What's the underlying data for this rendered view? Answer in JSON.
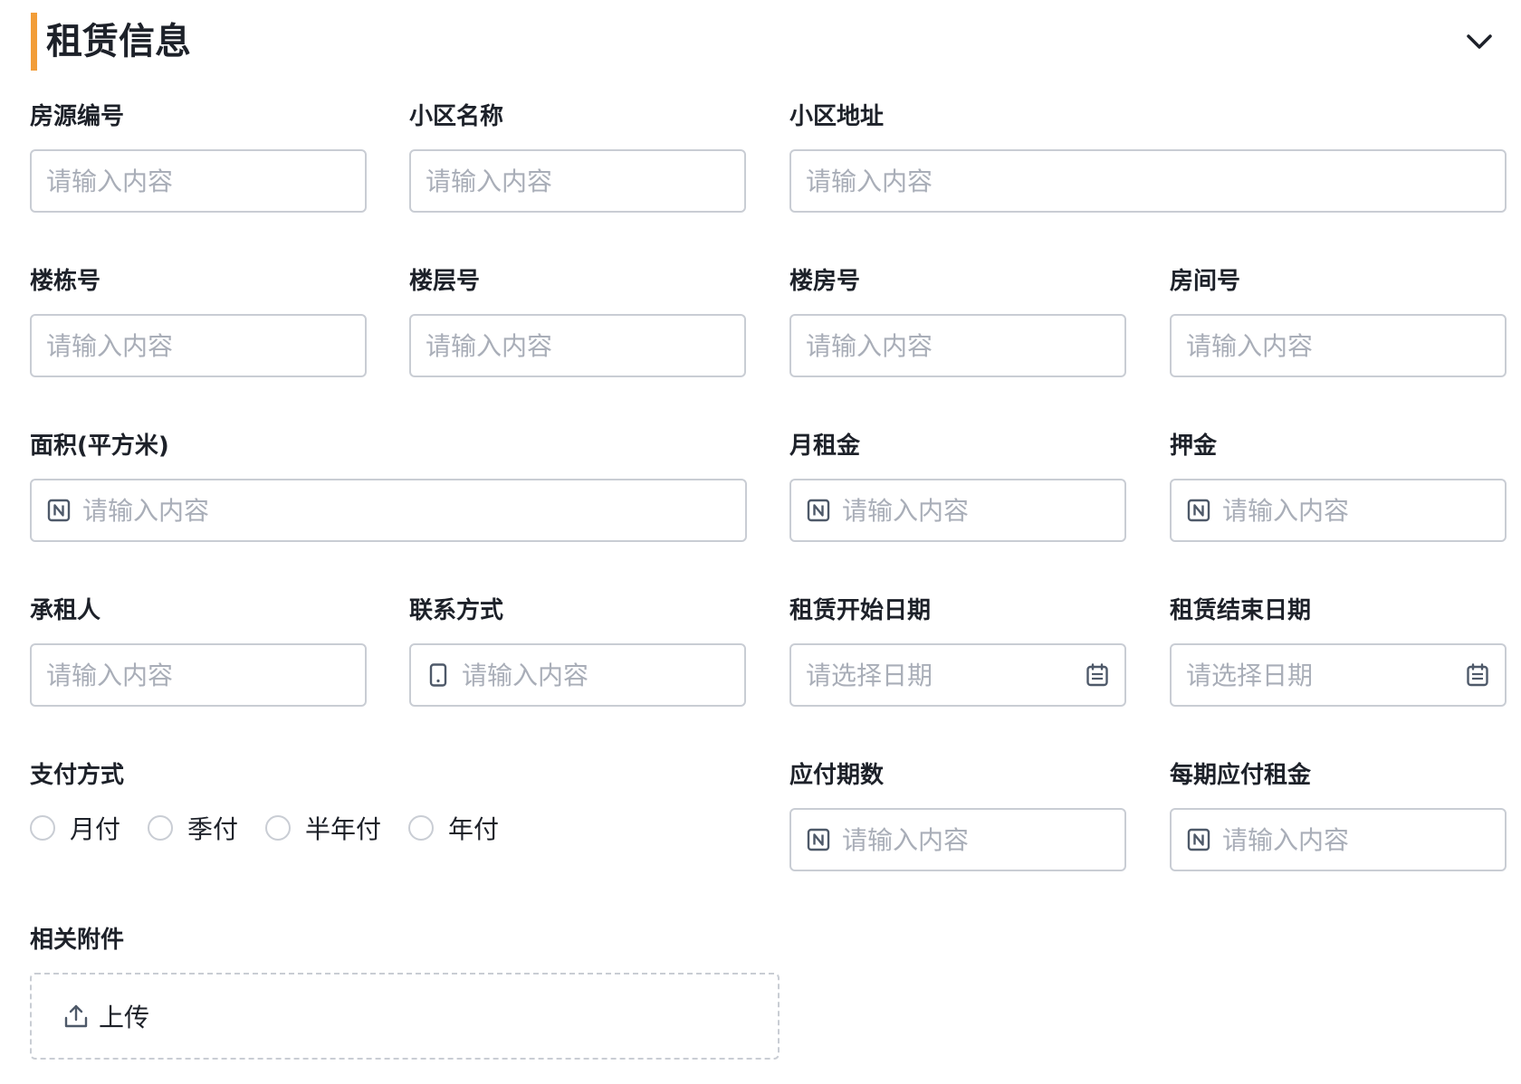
{
  "section": {
    "title": "租赁信息"
  },
  "colors": {
    "accent": "#f29d38",
    "border": "#c9cdd4",
    "placeholder": "#a9aeb8",
    "icon": "#4e5969"
  },
  "fields": {
    "house_code": {
      "label": "房源编号",
      "placeholder": "请输入内容"
    },
    "community_name": {
      "label": "小区名称",
      "placeholder": "请输入内容"
    },
    "community_address": {
      "label": "小区地址",
      "placeholder": "请输入内容"
    },
    "building_no": {
      "label": "楼栋号",
      "placeholder": "请输入内容"
    },
    "floor_no": {
      "label": "楼层号",
      "placeholder": "请输入内容"
    },
    "unit_no": {
      "label": "楼房号",
      "placeholder": "请输入内容"
    },
    "room_no": {
      "label": "房间号",
      "placeholder": "请输入内容"
    },
    "area": {
      "label": "面积(平方米)",
      "placeholder": "请输入内容",
      "icon": "number-icon"
    },
    "monthly_rent": {
      "label": "月租金",
      "placeholder": "请输入内容",
      "icon": "number-icon"
    },
    "deposit": {
      "label": "押金",
      "placeholder": "请输入内容",
      "icon": "number-icon"
    },
    "tenant": {
      "label": "承租人",
      "placeholder": "请输入内容"
    },
    "contact": {
      "label": "联系方式",
      "placeholder": "请输入内容",
      "icon": "phone-icon"
    },
    "start_date": {
      "label": "租赁开始日期",
      "placeholder": "请选择日期",
      "icon": "calendar-icon"
    },
    "end_date": {
      "label": "租赁结束日期",
      "placeholder": "请选择日期",
      "icon": "calendar-icon"
    },
    "payment_method": {
      "label": "支付方式",
      "options": [
        "月付",
        "季付",
        "半年付",
        "年付"
      ]
    },
    "installments": {
      "label": "应付期数",
      "placeholder": "请输入内容",
      "icon": "number-icon"
    },
    "rent_per_period": {
      "label": "每期应付租金",
      "placeholder": "请输入内容",
      "icon": "number-icon"
    },
    "attachments": {
      "label": "相关附件",
      "upload_label": "上传",
      "icon": "upload-icon"
    }
  }
}
